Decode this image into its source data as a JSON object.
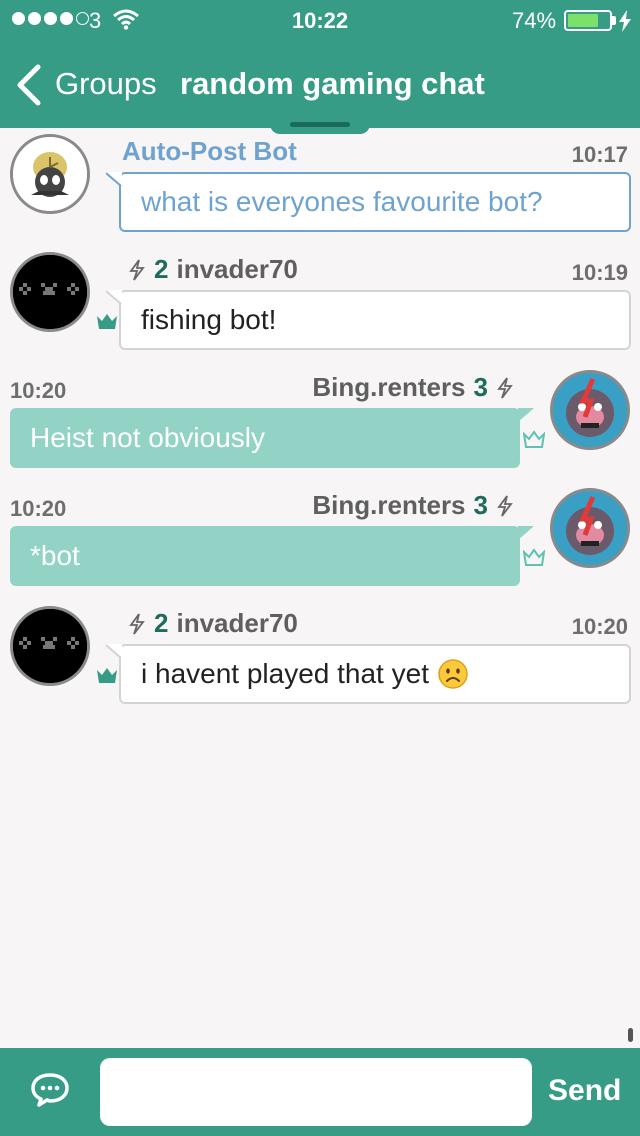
{
  "status_bar": {
    "carrier": "3",
    "time": "10:22",
    "battery_percent": "74%",
    "battery_level": 0.74
  },
  "nav": {
    "back_label": "Groups",
    "title": "random gaming chat"
  },
  "messages": [
    {
      "sender": "Auto-Post Bot",
      "time": "10:17",
      "text": "what is everyones favourite bot?",
      "direction": "incoming",
      "type": "bot"
    },
    {
      "sender": "invader70",
      "level": "2",
      "time": "10:19",
      "text": "fishing bot!",
      "direction": "incoming"
    },
    {
      "sender": "Bing.renters",
      "level": "3",
      "time": "10:20",
      "text": "Heist not obviously",
      "direction": "outgoing"
    },
    {
      "sender": "Bing.renters",
      "level": "3",
      "time": "10:20",
      "text": "*bot",
      "direction": "outgoing"
    },
    {
      "sender": "invader70",
      "level": "2",
      "time": "10:20",
      "text": "i havent played that yet",
      "direction": "incoming",
      "emoji": "frowning-face"
    }
  ],
  "composer": {
    "placeholder": "",
    "send_label": "Send"
  },
  "colors": {
    "brand": "#369c86",
    "outgoing_bubble": "#92d3c6",
    "bot_accent": "#6fa3cf",
    "level_text": "#1f6b5c"
  }
}
